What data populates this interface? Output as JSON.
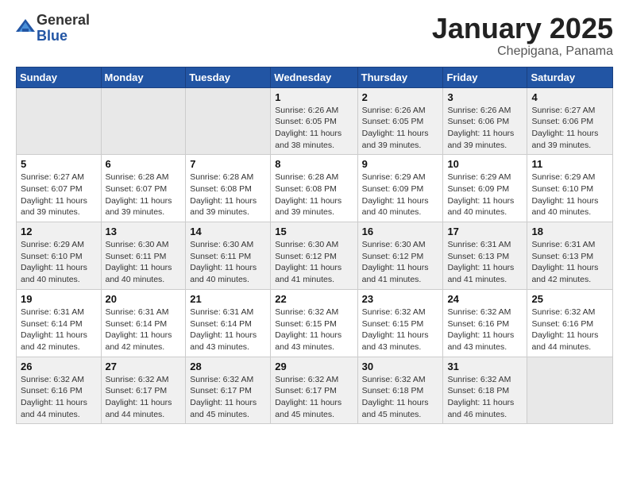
{
  "logo": {
    "general": "General",
    "blue": "Blue"
  },
  "title": {
    "month": "January 2025",
    "location": "Chepigana, Panama"
  },
  "weekdays": [
    "Sunday",
    "Monday",
    "Tuesday",
    "Wednesday",
    "Thursday",
    "Friday",
    "Saturday"
  ],
  "weeks": [
    [
      {
        "day": "",
        "info": ""
      },
      {
        "day": "",
        "info": ""
      },
      {
        "day": "",
        "info": ""
      },
      {
        "day": "1",
        "info": "Sunrise: 6:26 AM\nSunset: 6:05 PM\nDaylight: 11 hours and 38 minutes."
      },
      {
        "day": "2",
        "info": "Sunrise: 6:26 AM\nSunset: 6:05 PM\nDaylight: 11 hours and 39 minutes."
      },
      {
        "day": "3",
        "info": "Sunrise: 6:26 AM\nSunset: 6:06 PM\nDaylight: 11 hours and 39 minutes."
      },
      {
        "day": "4",
        "info": "Sunrise: 6:27 AM\nSunset: 6:06 PM\nDaylight: 11 hours and 39 minutes."
      }
    ],
    [
      {
        "day": "5",
        "info": "Sunrise: 6:27 AM\nSunset: 6:07 PM\nDaylight: 11 hours and 39 minutes."
      },
      {
        "day": "6",
        "info": "Sunrise: 6:28 AM\nSunset: 6:07 PM\nDaylight: 11 hours and 39 minutes."
      },
      {
        "day": "7",
        "info": "Sunrise: 6:28 AM\nSunset: 6:08 PM\nDaylight: 11 hours and 39 minutes."
      },
      {
        "day": "8",
        "info": "Sunrise: 6:28 AM\nSunset: 6:08 PM\nDaylight: 11 hours and 39 minutes."
      },
      {
        "day": "9",
        "info": "Sunrise: 6:29 AM\nSunset: 6:09 PM\nDaylight: 11 hours and 40 minutes."
      },
      {
        "day": "10",
        "info": "Sunrise: 6:29 AM\nSunset: 6:09 PM\nDaylight: 11 hours and 40 minutes."
      },
      {
        "day": "11",
        "info": "Sunrise: 6:29 AM\nSunset: 6:10 PM\nDaylight: 11 hours and 40 minutes."
      }
    ],
    [
      {
        "day": "12",
        "info": "Sunrise: 6:29 AM\nSunset: 6:10 PM\nDaylight: 11 hours and 40 minutes."
      },
      {
        "day": "13",
        "info": "Sunrise: 6:30 AM\nSunset: 6:11 PM\nDaylight: 11 hours and 40 minutes."
      },
      {
        "day": "14",
        "info": "Sunrise: 6:30 AM\nSunset: 6:11 PM\nDaylight: 11 hours and 40 minutes."
      },
      {
        "day": "15",
        "info": "Sunrise: 6:30 AM\nSunset: 6:12 PM\nDaylight: 11 hours and 41 minutes."
      },
      {
        "day": "16",
        "info": "Sunrise: 6:30 AM\nSunset: 6:12 PM\nDaylight: 11 hours and 41 minutes."
      },
      {
        "day": "17",
        "info": "Sunrise: 6:31 AM\nSunset: 6:13 PM\nDaylight: 11 hours and 41 minutes."
      },
      {
        "day": "18",
        "info": "Sunrise: 6:31 AM\nSunset: 6:13 PM\nDaylight: 11 hours and 42 minutes."
      }
    ],
    [
      {
        "day": "19",
        "info": "Sunrise: 6:31 AM\nSunset: 6:14 PM\nDaylight: 11 hours and 42 minutes."
      },
      {
        "day": "20",
        "info": "Sunrise: 6:31 AM\nSunset: 6:14 PM\nDaylight: 11 hours and 42 minutes."
      },
      {
        "day": "21",
        "info": "Sunrise: 6:31 AM\nSunset: 6:14 PM\nDaylight: 11 hours and 43 minutes."
      },
      {
        "day": "22",
        "info": "Sunrise: 6:32 AM\nSunset: 6:15 PM\nDaylight: 11 hours and 43 minutes."
      },
      {
        "day": "23",
        "info": "Sunrise: 6:32 AM\nSunset: 6:15 PM\nDaylight: 11 hours and 43 minutes."
      },
      {
        "day": "24",
        "info": "Sunrise: 6:32 AM\nSunset: 6:16 PM\nDaylight: 11 hours and 43 minutes."
      },
      {
        "day": "25",
        "info": "Sunrise: 6:32 AM\nSunset: 6:16 PM\nDaylight: 11 hours and 44 minutes."
      }
    ],
    [
      {
        "day": "26",
        "info": "Sunrise: 6:32 AM\nSunset: 6:16 PM\nDaylight: 11 hours and 44 minutes."
      },
      {
        "day": "27",
        "info": "Sunrise: 6:32 AM\nSunset: 6:17 PM\nDaylight: 11 hours and 44 minutes."
      },
      {
        "day": "28",
        "info": "Sunrise: 6:32 AM\nSunset: 6:17 PM\nDaylight: 11 hours and 45 minutes."
      },
      {
        "day": "29",
        "info": "Sunrise: 6:32 AM\nSunset: 6:17 PM\nDaylight: 11 hours and 45 minutes."
      },
      {
        "day": "30",
        "info": "Sunrise: 6:32 AM\nSunset: 6:18 PM\nDaylight: 11 hours and 45 minutes."
      },
      {
        "day": "31",
        "info": "Sunrise: 6:32 AM\nSunset: 6:18 PM\nDaylight: 11 hours and 46 minutes."
      },
      {
        "day": "",
        "info": ""
      }
    ]
  ],
  "shaded_rows": [
    0,
    2,
    4
  ]
}
